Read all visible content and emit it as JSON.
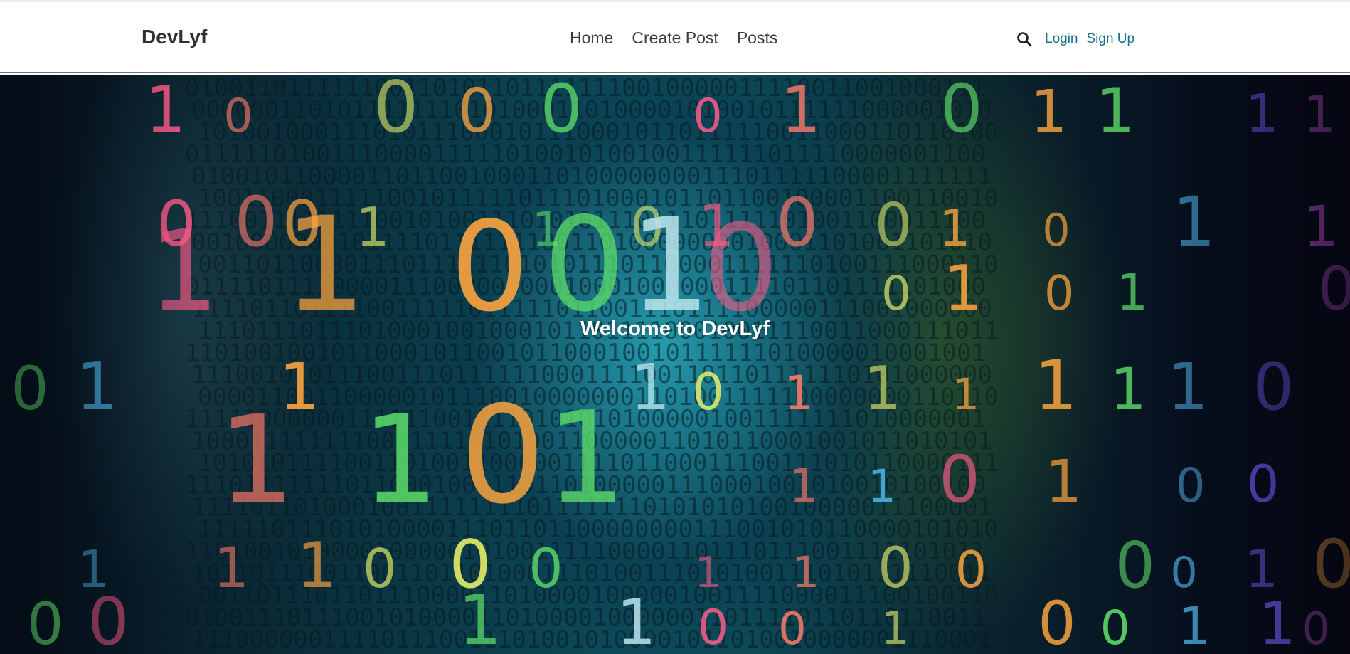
{
  "navbar": {
    "brand": "DevLyf",
    "links": [
      {
        "label": "Home"
      },
      {
        "label": "Create Post"
      },
      {
        "label": "Posts"
      }
    ],
    "search_icon": "search-icon",
    "auth": {
      "login": "Login",
      "signup": "Sign Up"
    }
  },
  "hero": {
    "title": "Welcome to DevLyf",
    "background": "binary-code-image"
  },
  "colors": {
    "link_accent": "#17728a",
    "navbar_bg": "#ffffff",
    "hero_text": "#ffffff"
  }
}
